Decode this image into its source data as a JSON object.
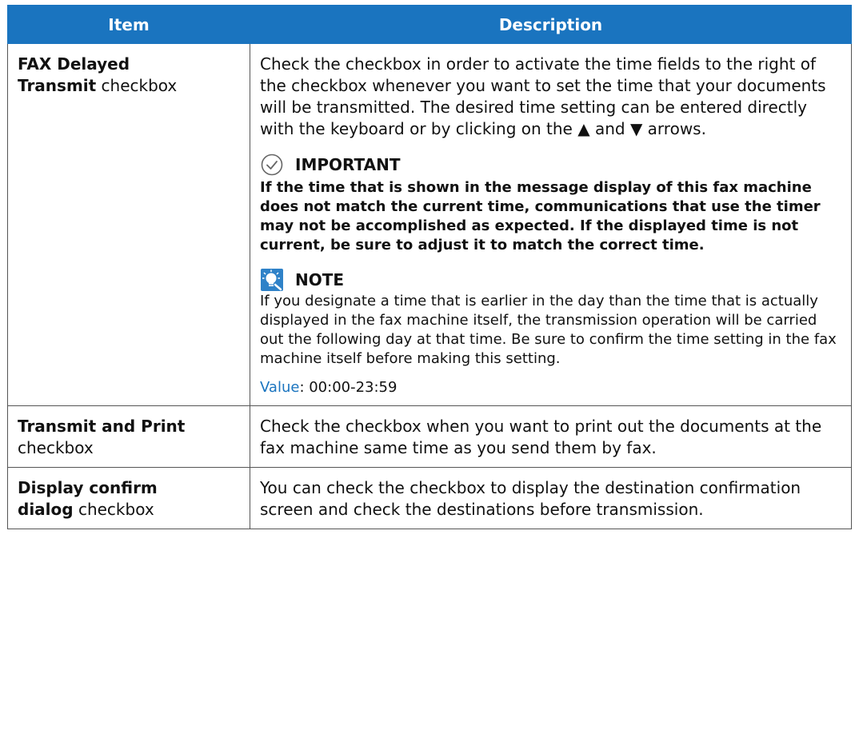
{
  "header": {
    "item": "Item",
    "description": "Description"
  },
  "rows": [
    {
      "item_bold_1": "FAX Delayed",
      "item_bold_2": "Transmit",
      "item_suffix": " checkbox",
      "description": "Check the checkbox in order to activate the time fields to the right of the checkbox whenever you want to set the time that your documents will be transmitted. The desired time setting can be entered directly with the keyboard or by clicking on the ▲ and ▼ arrows.",
      "important": {
        "icon": "check-circle-icon",
        "title": "IMPORTANT",
        "text": "If the time that is shown in the message display of this fax machine does not match the current time, communications that use the timer may not be accomplished as expected. If the displayed time is not current, be sure to adjust it to match the correct time."
      },
      "note": {
        "icon": "lightbulb-icon",
        "title": "NOTE",
        "text": "If you designate a time that is earlier in the day than the time that is actually displayed in the fax machine itself, the transmission operation will be carried out the following day at that time. Be sure to confirm the time setting in the fax machine itself before making this setting."
      },
      "value_label": "Value",
      "value_text": ": 00:00-23:59"
    },
    {
      "item_bold": "Transmit and Print",
      "item_suffix": "checkbox",
      "description": "Check the checkbox when you want to print out the documents at the fax machine same time as you send them by fax."
    },
    {
      "item_bold_1": "Display confirm",
      "item_bold_2": "dialog",
      "item_suffix": " checkbox",
      "description": "You can check the checkbox to display the destination confirmation screen and check the destinations before transmission."
    }
  ],
  "colors": {
    "header_bg": "#1a74bf",
    "value_label": "#1a74bf",
    "border": "#555555"
  }
}
